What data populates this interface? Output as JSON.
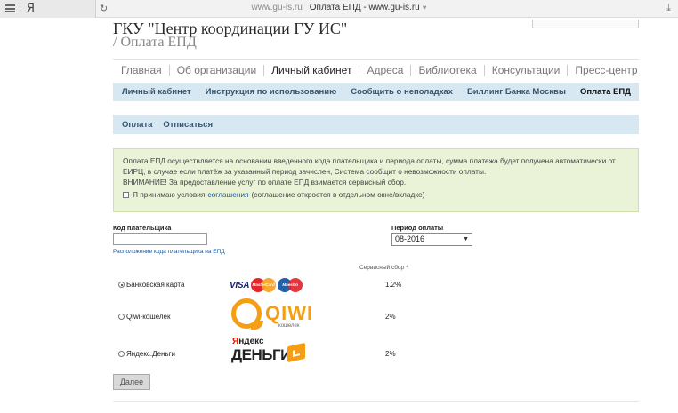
{
  "browser": {
    "logo": "Я",
    "url_domain": "www.gu-is.ru",
    "page_title": "Оплата ЕПД - www.gu-is.ru"
  },
  "header": {
    "title": "ГКУ \"Центр координации ГУ ИС\"",
    "subtitle": "/ Оплата ЕПД"
  },
  "main_nav": [
    "Главная",
    "Об организации",
    "Личный кабинет",
    "Адреса",
    "Библиотека",
    "Консультации",
    "Пресс-центр"
  ],
  "sub_nav": [
    "Личный кабинет",
    "Инструкция по использованию",
    "Сообщить о неполадках",
    "Биллинг Банка Москвы",
    "Оплата ЕПД"
  ],
  "sub_nav2": [
    "Оплата",
    "Отписаться"
  ],
  "notice": {
    "line1": "Оплата ЕПД осуществляется на основании введенного кода плательщика и периода оплаты, сумма платежа будет получена автоматически от",
    "line2": "ЕИРЦ, в случае если платёж за указанный период зачислен, Система сообщит о невозможности оплаты.",
    "line3": "ВНИМАНИЕ! За предоставление услуг по оплате ЕПД взимается сервисный сбор.",
    "agree_prefix": "Я принимаю условия",
    "agree_link": "соглашения",
    "agree_suffix": "(соглашение откроется в отдельном окне/вкладке)"
  },
  "form": {
    "payer_code_label": "Код плательщика",
    "payer_code_value": "",
    "payer_code_hint": "Расположение кода плательщика на ЕПД",
    "period_label": "Период оплаты",
    "period_value": "08-2016",
    "fee_header": "Сервисный сбор *"
  },
  "payment_methods": [
    {
      "label": "Банковская карта",
      "fee": "1.2%",
      "selected": true
    },
    {
      "label": "Qiwi-кошелек",
      "fee": "2%",
      "selected": false
    },
    {
      "label": "Яндекс.Деньги",
      "fee": "2%",
      "selected": false
    }
  ],
  "logos": {
    "visa": "VISA",
    "mastercard": "MasterCard",
    "maestro": "Maestro",
    "qiwi": "QIWI",
    "qiwi_sub": "кошелек",
    "yandex_top_red": "Я",
    "yandex_top_rest": "ндекс",
    "yandex_bottom": "ДЕНЬГИ"
  },
  "next_button": "Далее"
}
